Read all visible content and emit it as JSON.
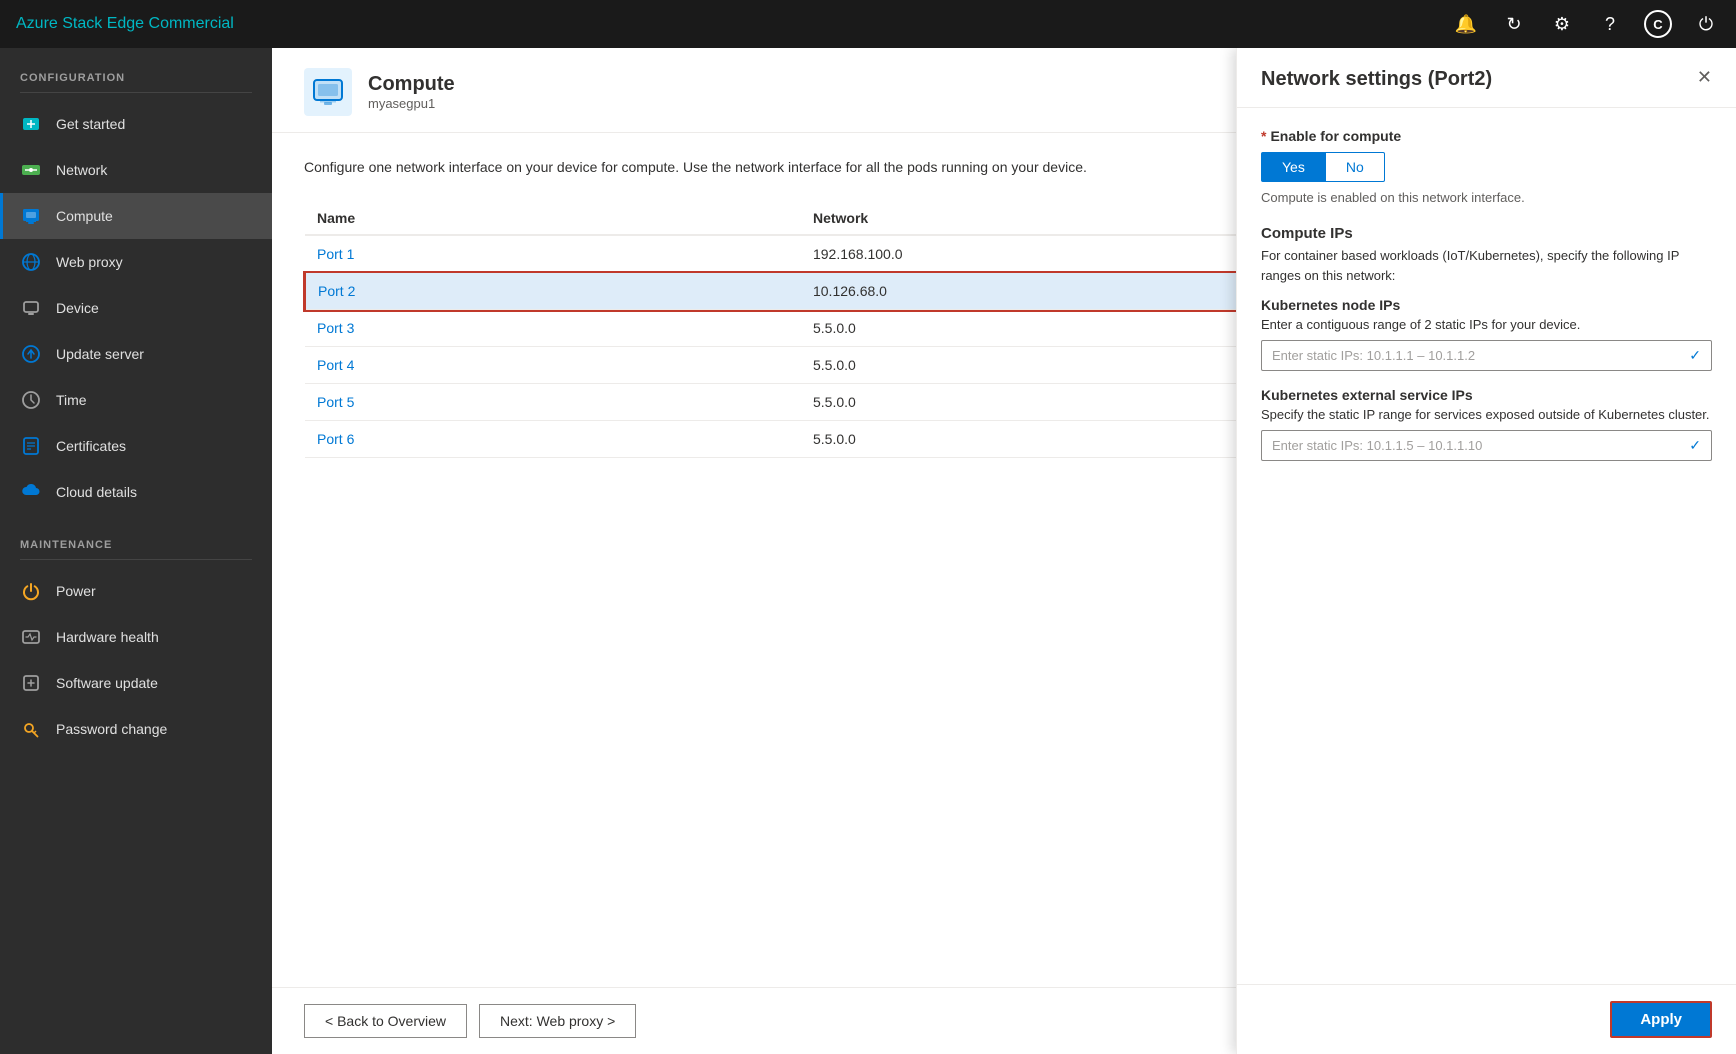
{
  "app": {
    "title": "Azure Stack Edge Commercial"
  },
  "topbar": {
    "icons": [
      "bell",
      "refresh",
      "gear",
      "help",
      "copyright",
      "power"
    ]
  },
  "sidebar": {
    "configuration_label": "CONFIGURATION",
    "maintenance_label": "MAINTENANCE",
    "items_config": [
      {
        "id": "get-started",
        "label": "Get started",
        "icon": "cloud-upload",
        "active": false
      },
      {
        "id": "network",
        "label": "Network",
        "icon": "network",
        "active": false
      },
      {
        "id": "compute",
        "label": "Compute",
        "icon": "compute",
        "active": true
      },
      {
        "id": "web-proxy",
        "label": "Web proxy",
        "icon": "globe",
        "active": false
      },
      {
        "id": "device",
        "label": "Device",
        "icon": "device",
        "active": false
      },
      {
        "id": "update-server",
        "label": "Update server",
        "icon": "arrow-up",
        "active": false
      },
      {
        "id": "time",
        "label": "Time",
        "icon": "clock",
        "active": false
      },
      {
        "id": "certificates",
        "label": "Certificates",
        "icon": "cert",
        "active": false
      },
      {
        "id": "cloud-details",
        "label": "Cloud details",
        "icon": "cloud",
        "active": false
      }
    ],
    "items_maintenance": [
      {
        "id": "power",
        "label": "Power",
        "icon": "power",
        "active": false
      },
      {
        "id": "hardware-health",
        "label": "Hardware health",
        "icon": "hw",
        "active": false
      },
      {
        "id": "software-update",
        "label": "Software update",
        "icon": "update",
        "active": false
      },
      {
        "id": "password-change",
        "label": "Password change",
        "icon": "key",
        "active": false
      }
    ]
  },
  "page": {
    "icon_color": "#0078d4",
    "title": "Compute",
    "subtitle": "myasegpu1",
    "description": "Configure one network interface on your device for compute. Use the network interface for all the pods running on your device.",
    "table": {
      "col_name": "Name",
      "col_network": "Network",
      "rows": [
        {
          "name": "Port 1",
          "network": "192.168.100.0",
          "selected": false
        },
        {
          "name": "Port 2",
          "network": "10.126.68.0",
          "selected": true
        },
        {
          "name": "Port 3",
          "network": "5.5.0.0",
          "selected": false
        },
        {
          "name": "Port 4",
          "network": "5.5.0.0",
          "selected": false
        },
        {
          "name": "Port 5",
          "network": "5.5.0.0",
          "selected": false
        },
        {
          "name": "Port 6",
          "network": "5.5.0.0",
          "selected": false
        }
      ]
    },
    "footer": {
      "back_label": "< Back to Overview",
      "next_label": "Next: Web proxy >"
    }
  },
  "side_panel": {
    "title": "Network settings (Port2)",
    "enable_label": "Enable for compute",
    "yes_label": "Yes",
    "no_label": "No",
    "enabled_hint": "Compute is enabled on this network interface.",
    "compute_ips_title": "Compute IPs",
    "compute_ips_desc": "For container based workloads (IoT/Kubernetes), specify the following IP ranges on this network:",
    "k8s_node_title": "Kubernetes node IPs",
    "k8s_node_desc": "Enter a contiguous range of 2 static IPs for your device.",
    "k8s_node_placeholder": "Enter static IPs: 10.1.1.1 – 10.1.1.2",
    "k8s_ext_title": "Kubernetes external service IPs",
    "k8s_ext_desc": "Specify the static IP range for services exposed outside of Kubernetes cluster.",
    "k8s_ext_placeholder": "Enter static IPs: 10.1.1.5 – 10.1.1.10",
    "apply_label": "Apply"
  }
}
